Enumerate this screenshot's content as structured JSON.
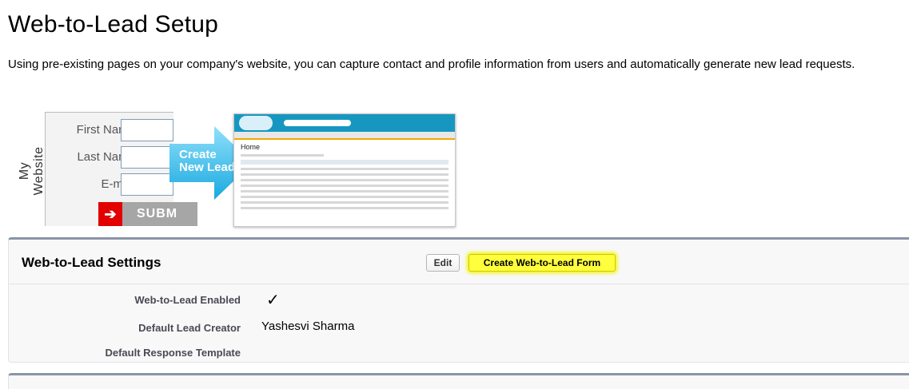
{
  "page": {
    "title": "Web-to-Lead Setup",
    "intro": "Using pre-existing pages on your company's website, you can capture contact and profile information from users and automatically generate new lead requests."
  },
  "illustration": {
    "side_label": "My Website",
    "fields": [
      "First Name",
      "Last Name",
      "E-mail"
    ],
    "submit_label": "SUBM",
    "arrow_text_line1": "Create",
    "arrow_text_line2": "New Lead",
    "screenshot_heading": "Home"
  },
  "settings": {
    "title": "Web-to-Lead Settings",
    "edit_label": "Edit",
    "create_form_label": "Create Web-to-Lead Form",
    "fields": [
      {
        "label": "Web-to-Lead Enabled",
        "value": "✓"
      },
      {
        "label": "Default Lead Creator",
        "value": "Yashesvi Sharma"
      },
      {
        "label": "Default Response Template",
        "value": ""
      }
    ]
  },
  "colors": {
    "highlight": "#ffff3d",
    "panel_border": "#8a94a8",
    "arrow": "#3cc0ef"
  }
}
